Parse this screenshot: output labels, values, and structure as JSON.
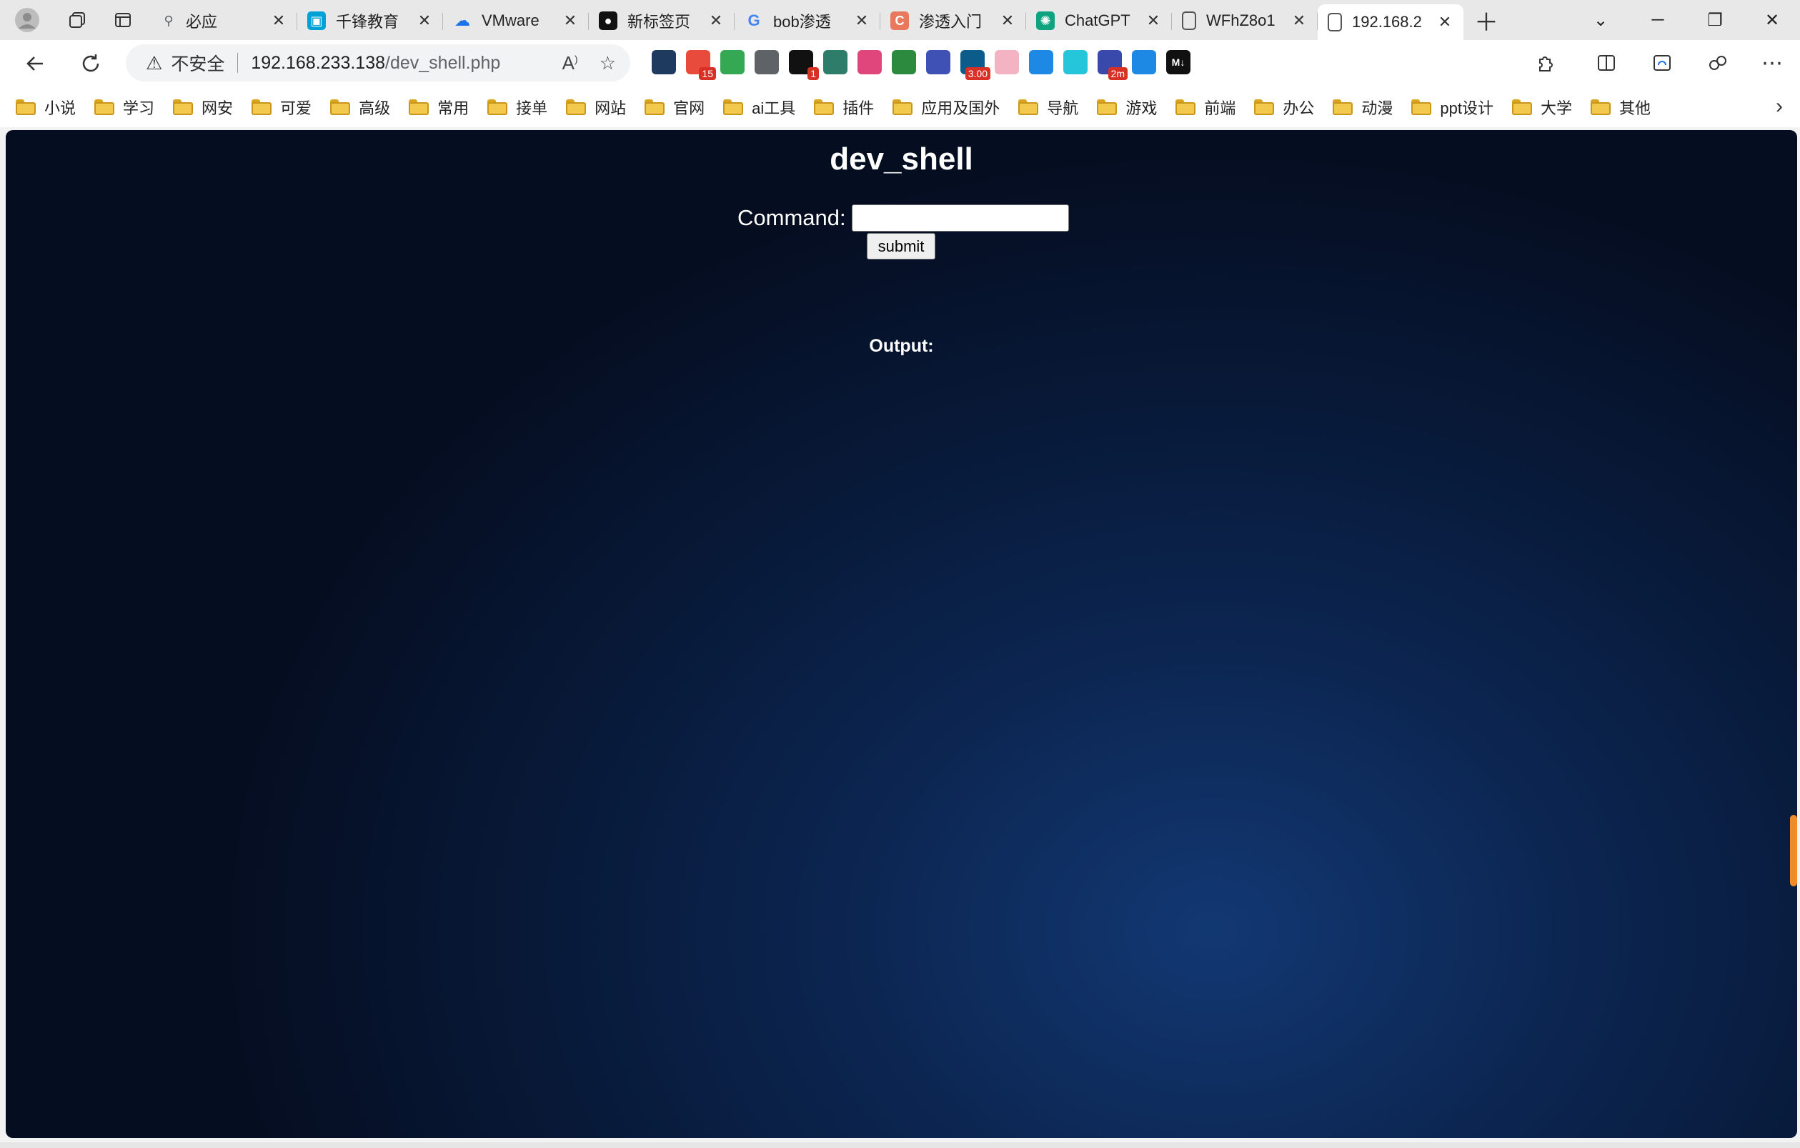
{
  "tabs": [
    {
      "title": "必应",
      "icon": "search-icon",
      "color": "#5f6368"
    },
    {
      "title": "千锋教育",
      "icon": "bilibili-icon",
      "color": "#00a1d6"
    },
    {
      "title": "VMware",
      "icon": "cloud-icon",
      "color": "#1a73e8"
    },
    {
      "title": "新标签页",
      "icon": "github-icon",
      "color": "#111111"
    },
    {
      "title": "bob渗透",
      "icon": "google-icon",
      "color": "#4285f4"
    },
    {
      "title": "渗透入门",
      "icon": "csdn-icon",
      "color": "#e8795f"
    },
    {
      "title": "ChatGPT",
      "icon": "chatgpt-icon",
      "color": "#10a37f"
    },
    {
      "title": "WFhZ8o1",
      "icon": "page-icon",
      "color": "#555555"
    },
    {
      "title": "192.168.2",
      "icon": "page-icon",
      "color": "#555555",
      "active": true
    }
  ],
  "address": {
    "security_text": "不安全",
    "host": "192.168.233.138",
    "path": "/dev_shell.php"
  },
  "extensions": [
    {
      "name": "shield-ext-icon",
      "color": "#1f3a5f"
    },
    {
      "name": "tab-manager-ext-icon",
      "color": "#e84b3c",
      "badge": "15"
    },
    {
      "name": "adguard-ext-icon",
      "color": "#34a853"
    },
    {
      "name": "copy-ext-icon",
      "color": "#5f6368"
    },
    {
      "name": "black-ext-icon",
      "color": "#111111",
      "badge": "1"
    },
    {
      "name": "hack-ext-icon",
      "color": "#2e7d6b"
    },
    {
      "name": "translate-ext-icon",
      "color": "#e0457b"
    },
    {
      "name": "globe-ext-icon",
      "color": "#2b8a3e"
    },
    {
      "name": "circle-ext-icon",
      "color": "#3f51b5"
    },
    {
      "name": "speed-ext-icon",
      "color": "#0b5c8a",
      "badge": "3.00"
    },
    {
      "name": "cat-ext-icon",
      "color": "#f4b3c2"
    },
    {
      "name": "wifi-ext-icon",
      "color": "#1e88e5"
    },
    {
      "name": "audio-ext-icon",
      "color": "#26c6da"
    },
    {
      "name": "timer-ext-icon",
      "color": "#3949ab",
      "badge": "2m"
    },
    {
      "name": "person-ext-icon",
      "color": "#1e88e5"
    },
    {
      "name": "markdown-ext-icon",
      "color": "#111111",
      "label": "M↓"
    }
  ],
  "bookmarks": [
    "小说",
    "学习",
    "网安",
    "可爱",
    "高级",
    "常用",
    "接单",
    "网站",
    "官网",
    "ai工具",
    "插件",
    "应用及国外",
    "导航",
    "游戏",
    "前端",
    "办公",
    "动漫",
    "ppt设计",
    "大学",
    "其他"
  ],
  "page": {
    "title": "dev_shell",
    "command_label": "Command:",
    "command_value": "",
    "submit_label": "submit",
    "output_label": "Output:"
  },
  "colors": {
    "page_bg_dark": "#050d20",
    "page_bg_glow": "#123873",
    "page_text": "#ffffff"
  }
}
